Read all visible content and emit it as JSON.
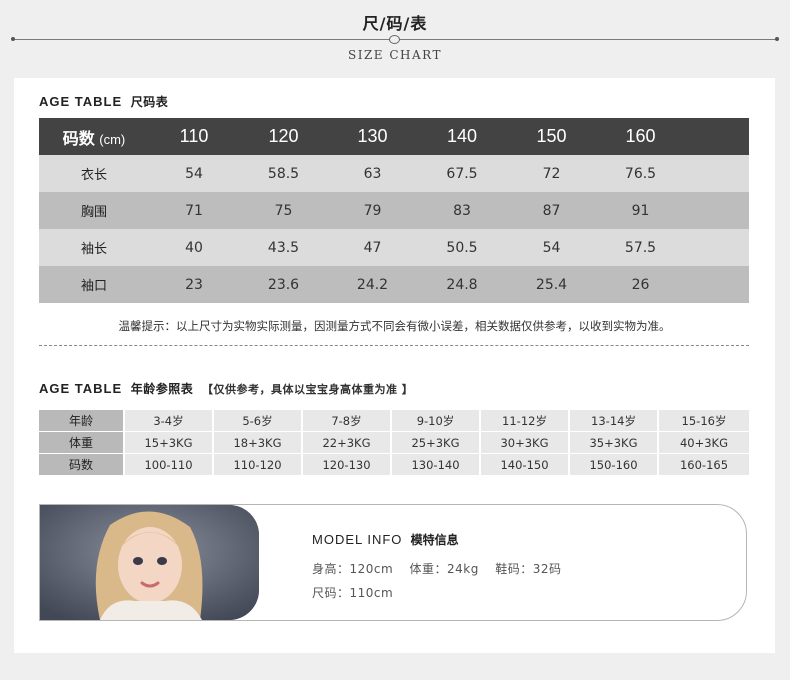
{
  "header": {
    "title": "尺/码/表",
    "subtitle": "SIZE CHART"
  },
  "size_section": {
    "title_en": "AGE TABLE",
    "title_cn": "尺码表"
  },
  "size_table": {
    "header_label": "码数",
    "header_unit": "(cm)",
    "sizes": [
      "110",
      "120",
      "130",
      "140",
      "150",
      "160"
    ],
    "rows": [
      {
        "label": "衣长",
        "values": [
          "54",
          "58.5",
          "63",
          "67.5",
          "72",
          "76.5"
        ]
      },
      {
        "label": "胸围",
        "values": [
          "71",
          "75",
          "79",
          "83",
          "87",
          "91"
        ]
      },
      {
        "label": "袖长",
        "values": [
          "40",
          "43.5",
          "47",
          "50.5",
          "54",
          "57.5"
        ]
      },
      {
        "label": "袖口",
        "values": [
          "23",
          "23.6",
          "24.2",
          "24.8",
          "25.4",
          "26"
        ]
      }
    ]
  },
  "tip": "温馨提示：以上尺寸为实物实际测量，因测量方式不同会有微小误差，相关数据仅供参考，以收到实物为准。",
  "age_section": {
    "title_en": "AGE TABLE",
    "title_cn": "年龄参照表",
    "note": "【仅供参考，具体以宝宝身高体重为准 】"
  },
  "age_table": {
    "rows": [
      {
        "label": "年龄",
        "values": [
          "3-4岁",
          "5-6岁",
          "7-8岁",
          "9-10岁",
          "11-12岁",
          "13-14岁",
          "15-16岁"
        ]
      },
      {
        "label": "体重",
        "values": [
          "15+3KG",
          "18+3KG",
          "22+3KG",
          "25+3KG",
          "30+3KG",
          "35+3KG",
          "40+3KG"
        ]
      },
      {
        "label": "码数",
        "values": [
          "100-110",
          "110-120",
          "120-130",
          "130-140",
          "140-150",
          "150-160",
          "160-165"
        ]
      }
    ]
  },
  "model": {
    "title_en": "MODEL INFO",
    "title_cn": "模特信息",
    "height": "身高：120cm",
    "weight": "体重：24kg",
    "shoe": "鞋码：32码",
    "size": "尺码：110cm"
  }
}
